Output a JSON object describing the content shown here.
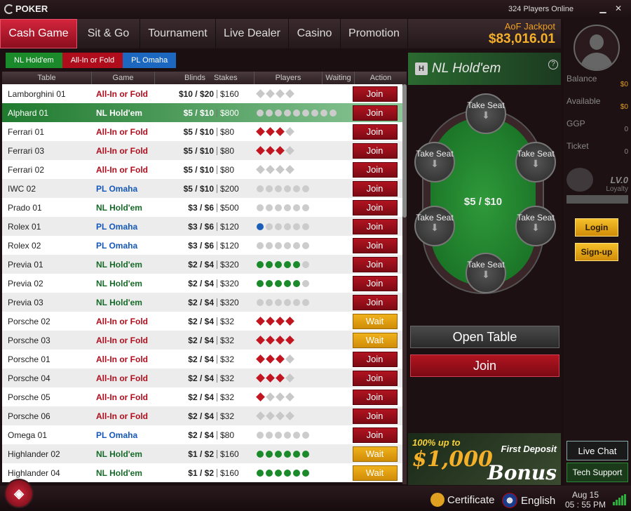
{
  "title": {
    "logo": "POKER",
    "online": "324 Players Online"
  },
  "tabs": [
    {
      "label": "Cash Game",
      "active": true
    },
    {
      "label": "Sit & Go"
    },
    {
      "label": "Tournament"
    },
    {
      "label": "Live Dealer"
    },
    {
      "label": "Casino"
    },
    {
      "label": "Promotion"
    }
  ],
  "jackpot": {
    "label": "AoF Jackpot",
    "value": "$83,016.01"
  },
  "filters": [
    {
      "label": "NL Hold'em",
      "color": "#1a8a2a"
    },
    {
      "label": "All-In or Fold",
      "color": "#b00d1c"
    },
    {
      "label": "PL Omaha",
      "color": "#1c68c0"
    }
  ],
  "columns": {
    "table": "Table",
    "game": "Game",
    "blinds": "Blinds",
    "stakes": "Stakes",
    "players": "Players",
    "waiting": "Waiting",
    "action": "Action"
  },
  "rows": [
    {
      "table": "Lamborghini 01",
      "game": "All-In or Fold",
      "type": "ai",
      "blinds": "$10 / $20",
      "stakes": "$160",
      "players": 0,
      "seats": 4,
      "action": "Join"
    },
    {
      "table": "Alphard 01",
      "game": "NL Hold'em",
      "type": "nl",
      "blinds": "$5 / $10",
      "stakes": "$800",
      "players": 0,
      "seats": 9,
      "action": "Join",
      "selected": true
    },
    {
      "table": "Ferrari 01",
      "game": "All-In or Fold",
      "type": "ai",
      "blinds": "$5 / $10",
      "stakes": "$80",
      "players": 3,
      "seats": 4,
      "action": "Join"
    },
    {
      "table": "Ferrari 03",
      "game": "All-In or Fold",
      "type": "ai",
      "blinds": "$5 / $10",
      "stakes": "$80",
      "players": 3,
      "seats": 4,
      "action": "Join"
    },
    {
      "table": "Ferrari 02",
      "game": "All-In or Fold",
      "type": "ai",
      "blinds": "$5 / $10",
      "stakes": "$80",
      "players": 0,
      "seats": 4,
      "action": "Join"
    },
    {
      "table": "IWC 02",
      "game": "PL Omaha",
      "type": "pl",
      "blinds": "$5 / $10",
      "stakes": "$200",
      "players": 0,
      "seats": 6,
      "action": "Join"
    },
    {
      "table": "Prado 01",
      "game": "NL Hold'em",
      "type": "nl",
      "blinds": "$3 / $6",
      "stakes": "$500",
      "players": 0,
      "seats": 6,
      "action": "Join"
    },
    {
      "table": "Rolex 01",
      "game": "PL Omaha",
      "type": "pl",
      "blinds": "$3 / $6",
      "stakes": "$120",
      "players": 1,
      "seats": 6,
      "action": "Join"
    },
    {
      "table": "Rolex 02",
      "game": "PL Omaha",
      "type": "pl",
      "blinds": "$3 / $6",
      "stakes": "$120",
      "players": 0,
      "seats": 6,
      "action": "Join"
    },
    {
      "table": "Previa 01",
      "game": "NL Hold'em",
      "type": "nl",
      "blinds": "$2 / $4",
      "stakes": "$320",
      "players": 5,
      "seats": 6,
      "action": "Join"
    },
    {
      "table": "Previa 02",
      "game": "NL Hold'em",
      "type": "nl",
      "blinds": "$2 / $4",
      "stakes": "$320",
      "players": 5,
      "seats": 6,
      "action": "Join"
    },
    {
      "table": "Previa 03",
      "game": "NL Hold'em",
      "type": "nl",
      "blinds": "$2 / $4",
      "stakes": "$320",
      "players": 0,
      "seats": 6,
      "action": "Join"
    },
    {
      "table": "Porsche 02",
      "game": "All-In or Fold",
      "type": "ai",
      "blinds": "$2 / $4",
      "stakes": "$32",
      "players": 4,
      "seats": 4,
      "action": "Wait"
    },
    {
      "table": "Porsche 03",
      "game": "All-In or Fold",
      "type": "ai",
      "blinds": "$2 / $4",
      "stakes": "$32",
      "players": 4,
      "seats": 4,
      "action": "Wait"
    },
    {
      "table": "Porsche 01",
      "game": "All-In or Fold",
      "type": "ai",
      "blinds": "$2 / $4",
      "stakes": "$32",
      "players": 3,
      "seats": 4,
      "action": "Join"
    },
    {
      "table": "Porsche 04",
      "game": "All-In or Fold",
      "type": "ai",
      "blinds": "$2 / $4",
      "stakes": "$32",
      "players": 3,
      "seats": 4,
      "action": "Join"
    },
    {
      "table": "Porsche 05",
      "game": "All-In or Fold",
      "type": "ai",
      "blinds": "$2 / $4",
      "stakes": "$32",
      "players": 1,
      "seats": 4,
      "action": "Join"
    },
    {
      "table": "Porsche 06",
      "game": "All-In or Fold",
      "type": "ai",
      "blinds": "$2 / $4",
      "stakes": "$32",
      "players": 0,
      "seats": 4,
      "action": "Join"
    },
    {
      "table": "Omega 01",
      "game": "PL Omaha",
      "type": "pl",
      "blinds": "$2 / $4",
      "stakes": "$80",
      "players": 0,
      "seats": 6,
      "action": "Join"
    },
    {
      "table": "Highlander 02",
      "game": "NL Hold'em",
      "type": "nl",
      "blinds": "$1 / $2",
      "stakes": "$160",
      "players": 6,
      "seats": 6,
      "action": "Wait"
    },
    {
      "table": "Highlander 04",
      "game": "NL Hold'em",
      "type": "nl",
      "blinds": "$1 / $2",
      "stakes": "$160",
      "players": 6,
      "seats": 6,
      "action": "Wait"
    }
  ],
  "detail": {
    "game": "NL Hold'em",
    "game_icon": "H",
    "blinds": "$5 / $10",
    "seat_label": "Take Seat",
    "open_table": "Open Table",
    "join": "Join"
  },
  "promo": {
    "line1": "100% up to",
    "line2": "$1,000",
    "line3": "First Deposit",
    "line4": "Bonus"
  },
  "account": {
    "balance_label": "Balance",
    "balance": "$0",
    "available_label": "Available",
    "available": "$0",
    "ggp_label": "GGP",
    "ggp": "0",
    "ticket_label": "Ticket",
    "ticket": "0",
    "level": "LV.0",
    "loyalty": "Loyalty",
    "login": "Login",
    "signup": "Sign-up",
    "live_chat": "Live Chat",
    "tech_support": "Tech Support"
  },
  "footer": {
    "certificate": "Certificate",
    "language": "English",
    "date": "Aug 15",
    "time": "05 : 55 PM"
  }
}
